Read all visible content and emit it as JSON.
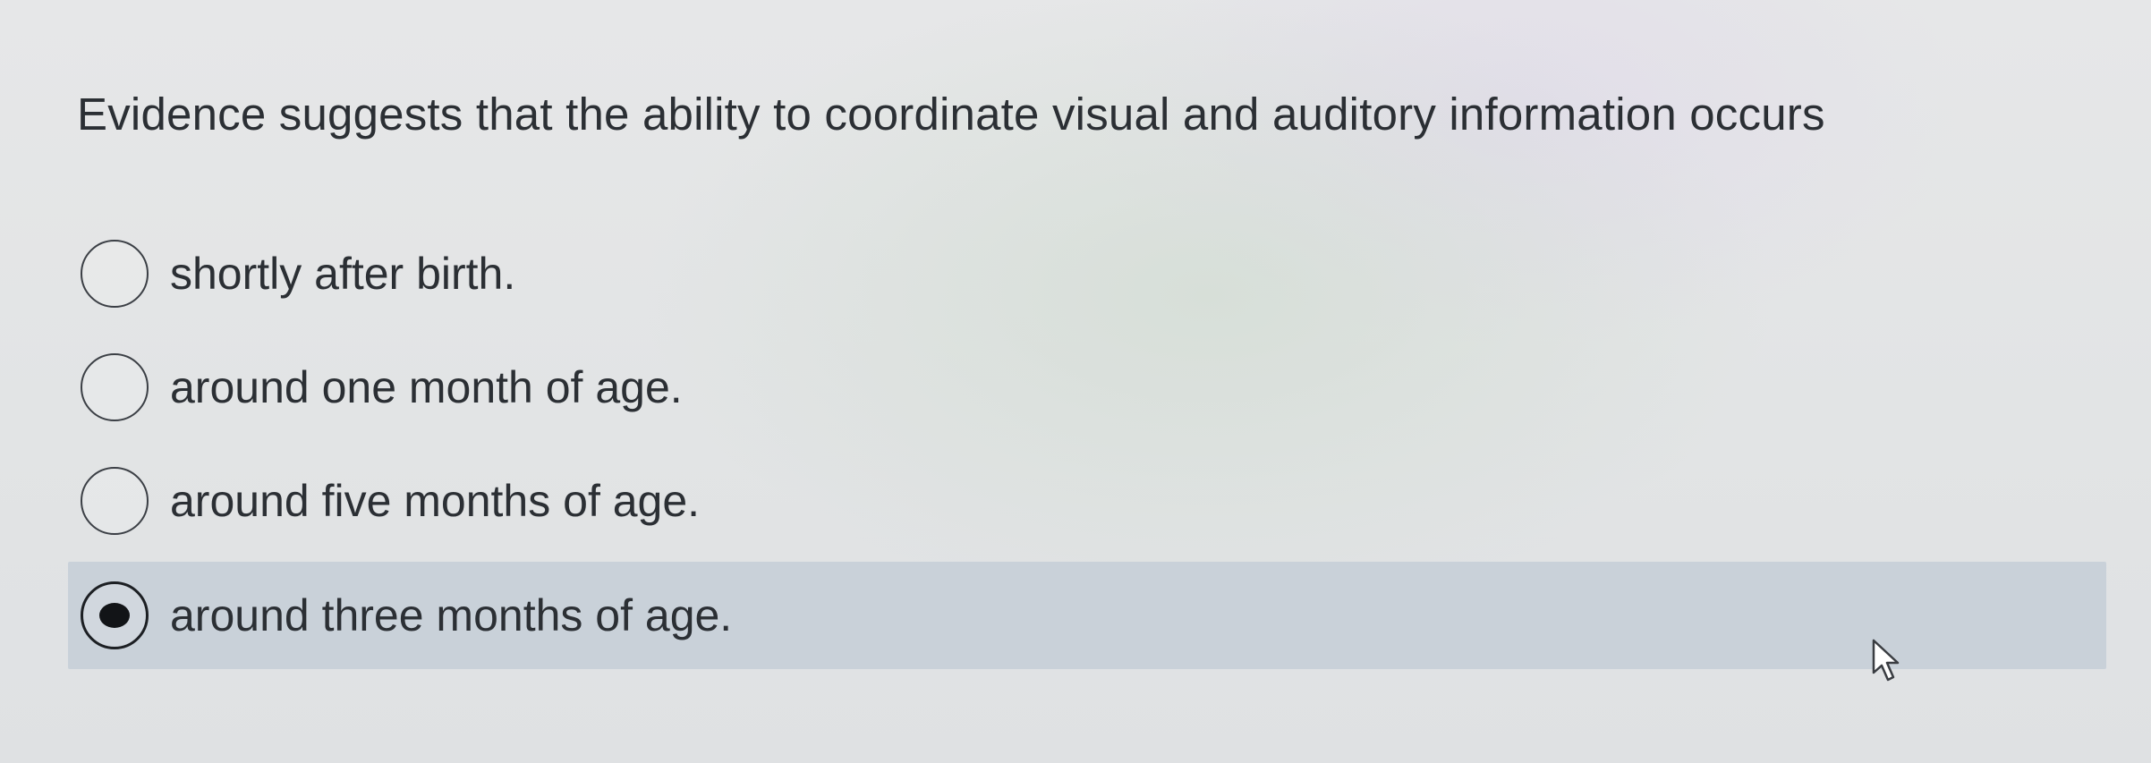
{
  "question": {
    "text": "Evidence suggests that the ability to coordinate visual and auditory information occurs"
  },
  "options": [
    {
      "label": "shortly after birth.",
      "selected": false
    },
    {
      "label": "around one month of age.",
      "selected": false
    },
    {
      "label": "around five months of age.",
      "selected": false
    },
    {
      "label": "around three months of age.",
      "selected": true
    }
  ],
  "colors": {
    "selected_row": "#c9d1d9",
    "text": "#2b2f34",
    "radio_border": "#3b3f45"
  },
  "icons": {
    "cursor": "mouse-pointer-icon"
  }
}
